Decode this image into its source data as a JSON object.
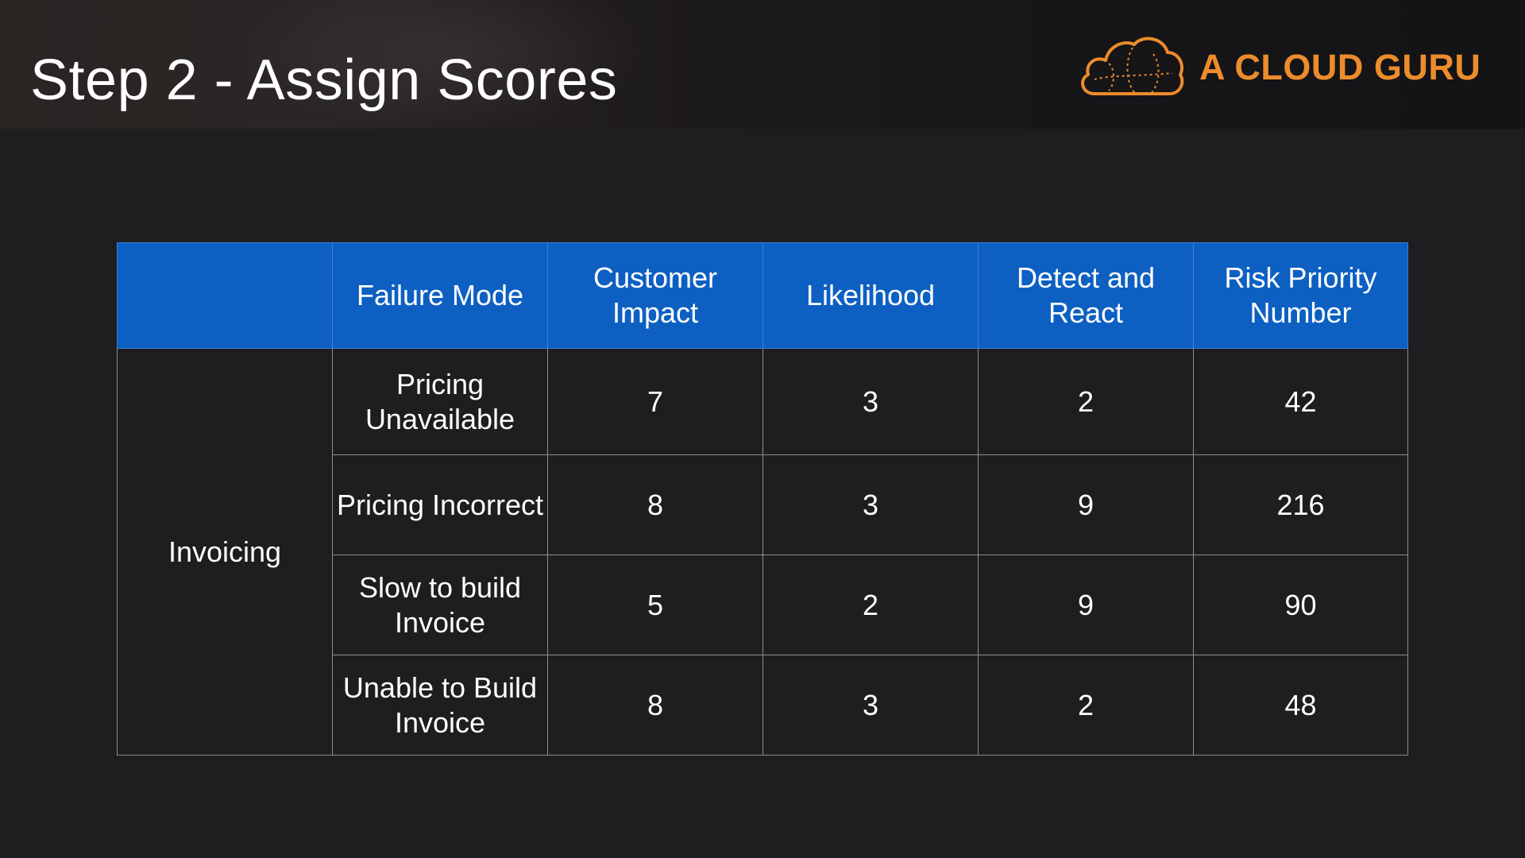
{
  "slide": {
    "title": "Step 2 - Assign Scores"
  },
  "brand": {
    "name": "A CLOUD GURU",
    "icon": "cloud-logo-icon",
    "color": "#ec8c2c"
  },
  "colors": {
    "header_fill": "#0d60c2",
    "background": "#1e1d20",
    "text": "#ffffff",
    "grid": "#8e8e92"
  },
  "table": {
    "headers": [
      "",
      "Failure Mode",
      "Customer Impact",
      "Likelihood",
      "Detect and React",
      "Risk Priority Number"
    ],
    "group_label": "Invoicing",
    "rows": [
      {
        "failure_mode": "Pricing Unavailable",
        "customer_impact": "7",
        "likelihood": "3",
        "detect_react": "2",
        "rpn": "42"
      },
      {
        "failure_mode": "Pricing Incorrect",
        "customer_impact": "8",
        "likelihood": "3",
        "detect_react": "9",
        "rpn": "216"
      },
      {
        "failure_mode": "Slow to build Invoice",
        "customer_impact": "5",
        "likelihood": "2",
        "detect_react": "9",
        "rpn": "90"
      },
      {
        "failure_mode": "Unable to Build Invoice",
        "customer_impact": "8",
        "likelihood": "3",
        "detect_react": "2",
        "rpn": "48"
      }
    ]
  }
}
